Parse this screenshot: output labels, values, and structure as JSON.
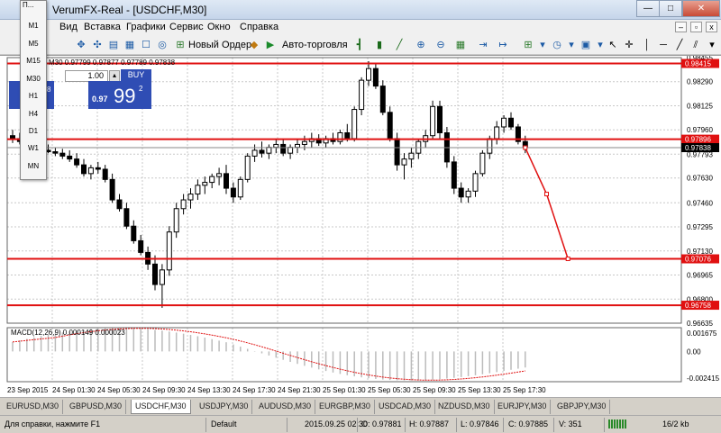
{
  "window": {
    "title": "VerumFX-Real - [USDCHF,M30]",
    "controls": [
      "—",
      "□",
      "✕"
    ]
  },
  "menu": [
    "Вид",
    "Вставка",
    "Графики",
    "Сервис",
    "Окно",
    "Справка"
  ],
  "toolbar": {
    "new_order": "Новый Ордер",
    "auto_trading": "Авто-торговля"
  },
  "timeframes": [
    "M1",
    "M5",
    "M15",
    "M30",
    "H1",
    "H4",
    "D1",
    "W1",
    "MN"
  ],
  "chart": {
    "quote_line": "M30  0.97799 0.97877 0.97789 0.97838",
    "one_click": {
      "lot": "1.00",
      "buy_label": "BUY",
      "sell_big": "3",
      "sell_sup": "8",
      "buy_small": "0.97",
      "buy_big": "99",
      "buy_sup": "2"
    },
    "price_axis": [
      "0.98455",
      "0.98290",
      "0.98125",
      "0.97960",
      "0.97793",
      "0.97630",
      "0.97460",
      "0.97295",
      "0.97130",
      "0.96965",
      "0.96800",
      "0.96635"
    ],
    "tags": {
      "top": "0.98415",
      "mid": "0.97896",
      "current": "0.97838",
      "low1": "0.97076",
      "low2": "0.96758"
    },
    "time_axis": [
      "23 Sep 2015",
      "24 Sep 01:30",
      "24 Sep 05:30",
      "24 Sep 09:30",
      "24 Sep 13:30",
      "24 Sep 17:30",
      "24 Sep 21:30",
      "25 Sep 01:30",
      "25 Sep 05:30",
      "25 Sep 09:30",
      "25 Sep 13:30",
      "25 Sep 17:30"
    ],
    "macd": {
      "label": "MACD(12,26,9) 0.000149 0.000023",
      "axis": [
        "0.001675",
        "0.00",
        "-0.002415"
      ]
    }
  },
  "chart_data": {
    "type": "candlestick",
    "symbol": "USDCHF",
    "timeframe": "M30",
    "ylim": [
      0.96635,
      0.98455
    ],
    "candles": [
      [
        0.9792,
        0.9796,
        0.9787,
        0.979
      ],
      [
        0.979,
        0.9794,
        0.9786,
        0.9788
      ],
      [
        0.9788,
        0.9791,
        0.9783,
        0.9785
      ],
      [
        0.9785,
        0.9788,
        0.9782,
        0.9784
      ],
      [
        0.9784,
        0.9787,
        0.978,
        0.9782
      ],
      [
        0.9782,
        0.9786,
        0.978,
        0.9781
      ],
      [
        0.9781,
        0.9784,
        0.9778,
        0.978
      ],
      [
        0.978,
        0.9783,
        0.9776,
        0.9778
      ],
      [
        0.9778,
        0.9782,
        0.9774,
        0.9776
      ],
      [
        0.9776,
        0.978,
        0.977,
        0.9772
      ],
      [
        0.9772,
        0.9776,
        0.9764,
        0.9766
      ],
      [
        0.9766,
        0.9772,
        0.9762,
        0.977
      ],
      [
        0.977,
        0.9774,
        0.9766,
        0.9769
      ],
      [
        0.9769,
        0.9772,
        0.976,
        0.9762
      ],
      [
        0.9762,
        0.9766,
        0.9746,
        0.9748
      ],
      [
        0.9748,
        0.9752,
        0.974,
        0.9742
      ],
      [
        0.9742,
        0.9746,
        0.9728,
        0.973
      ],
      [
        0.973,
        0.9734,
        0.9718,
        0.972
      ],
      [
        0.972,
        0.9724,
        0.971,
        0.9712
      ],
      [
        0.9712,
        0.9716,
        0.97,
        0.9704
      ],
      [
        0.9704,
        0.971,
        0.9686,
        0.969
      ],
      [
        0.969,
        0.9704,
        0.9674,
        0.97
      ],
      [
        0.97,
        0.973,
        0.9696,
        0.9726
      ],
      [
        0.9726,
        0.9746,
        0.9722,
        0.9742
      ],
      [
        0.9742,
        0.9752,
        0.9738,
        0.9748
      ],
      [
        0.9748,
        0.9756,
        0.9742,
        0.9752
      ],
      [
        0.9752,
        0.9762,
        0.9748,
        0.9758
      ],
      [
        0.9758,
        0.9764,
        0.9752,
        0.976
      ],
      [
        0.976,
        0.9766,
        0.9756,
        0.9764
      ],
      [
        0.9764,
        0.977,
        0.9758,
        0.9766
      ],
      [
        0.9766,
        0.9772,
        0.9752,
        0.9756
      ],
      [
        0.9756,
        0.976,
        0.9746,
        0.975
      ],
      [
        0.975,
        0.9764,
        0.9748,
        0.9762
      ],
      [
        0.9762,
        0.978,
        0.976,
        0.9778
      ],
      [
        0.9778,
        0.9786,
        0.9774,
        0.9782
      ],
      [
        0.9782,
        0.9788,
        0.9777,
        0.978
      ],
      [
        0.978,
        0.9786,
        0.9776,
        0.9784
      ],
      [
        0.9784,
        0.979,
        0.978,
        0.9786
      ],
      [
        0.9786,
        0.979,
        0.9778,
        0.978
      ],
      [
        0.978,
        0.9786,
        0.9776,
        0.9784
      ],
      [
        0.9784,
        0.979,
        0.978,
        0.9786
      ],
      [
        0.9786,
        0.9792,
        0.9782,
        0.9788
      ],
      [
        0.9788,
        0.9794,
        0.9784,
        0.979
      ],
      [
        0.979,
        0.9793,
        0.9785,
        0.9787
      ],
      [
        0.9787,
        0.9792,
        0.9784,
        0.979
      ],
      [
        0.979,
        0.9794,
        0.9786,
        0.9788
      ],
      [
        0.9788,
        0.9796,
        0.9786,
        0.9794
      ],
      [
        0.9794,
        0.98,
        0.9788,
        0.979
      ],
      [
        0.979,
        0.9812,
        0.9788,
        0.981
      ],
      [
        0.981,
        0.9832,
        0.9806,
        0.983
      ],
      [
        0.983,
        0.9843,
        0.9826,
        0.9838
      ],
      [
        0.9838,
        0.9842,
        0.9824,
        0.9826
      ],
      [
        0.9826,
        0.983,
        0.9806,
        0.9808
      ],
      [
        0.9808,
        0.9812,
        0.9788,
        0.979
      ],
      [
        0.979,
        0.9794,
        0.9768,
        0.9772
      ],
      [
        0.9772,
        0.978,
        0.9762,
        0.9776
      ],
      [
        0.9776,
        0.9784,
        0.977,
        0.978
      ],
      [
        0.978,
        0.979,
        0.9776,
        0.9788
      ],
      [
        0.9788,
        0.9796,
        0.9784,
        0.9792
      ],
      [
        0.9792,
        0.9816,
        0.979,
        0.9812
      ],
      [
        0.9812,
        0.9816,
        0.979,
        0.9794
      ],
      [
        0.9794,
        0.9798,
        0.977,
        0.9774
      ],
      [
        0.9774,
        0.9778,
        0.9752,
        0.9756
      ],
      [
        0.9756,
        0.976,
        0.9746,
        0.975
      ],
      [
        0.975,
        0.9756,
        0.9746,
        0.9754
      ],
      [
        0.9754,
        0.9768,
        0.975,
        0.9766
      ],
      [
        0.9766,
        0.9782,
        0.9764,
        0.978
      ],
      [
        0.978,
        0.9792,
        0.9776,
        0.979
      ],
      [
        0.979,
        0.9802,
        0.9786,
        0.9798
      ],
      [
        0.9798,
        0.9806,
        0.9794,
        0.9804
      ],
      [
        0.9804,
        0.9808,
        0.9796,
        0.9798
      ],
      [
        0.9798,
        0.98,
        0.9786,
        0.9788
      ],
      [
        0.9788,
        0.9792,
        0.978,
        0.9784
      ]
    ],
    "levels": [
      0.98415,
      0.97896,
      0.97838,
      0.97076,
      0.96758
    ],
    "projection": [
      [
        72,
        0.97838
      ],
      [
        75,
        0.9752
      ],
      [
        78,
        0.97076
      ]
    ]
  },
  "tabs": [
    "EURUSD,M30",
    "GBPUSD,M30",
    "USDCHF,M30",
    "USDJPY,M30",
    "AUDUSD,M30",
    "EURGBP,M30",
    "USDCAD,M30",
    "NZDUSD,M30",
    "EURJPY,M30",
    "GBPJPY,M30"
  ],
  "active_tab": 2,
  "status": {
    "help": "Для справки, нажмите F1",
    "profile": "Default",
    "time": "2015.09.25 02:30",
    "open": "O: 0.97881",
    "high": "H: 0.97887",
    "low": "L: 0.97846",
    "close": "C: 0.97885",
    "volume": "V: 351",
    "traffic": "16/2 kb"
  }
}
